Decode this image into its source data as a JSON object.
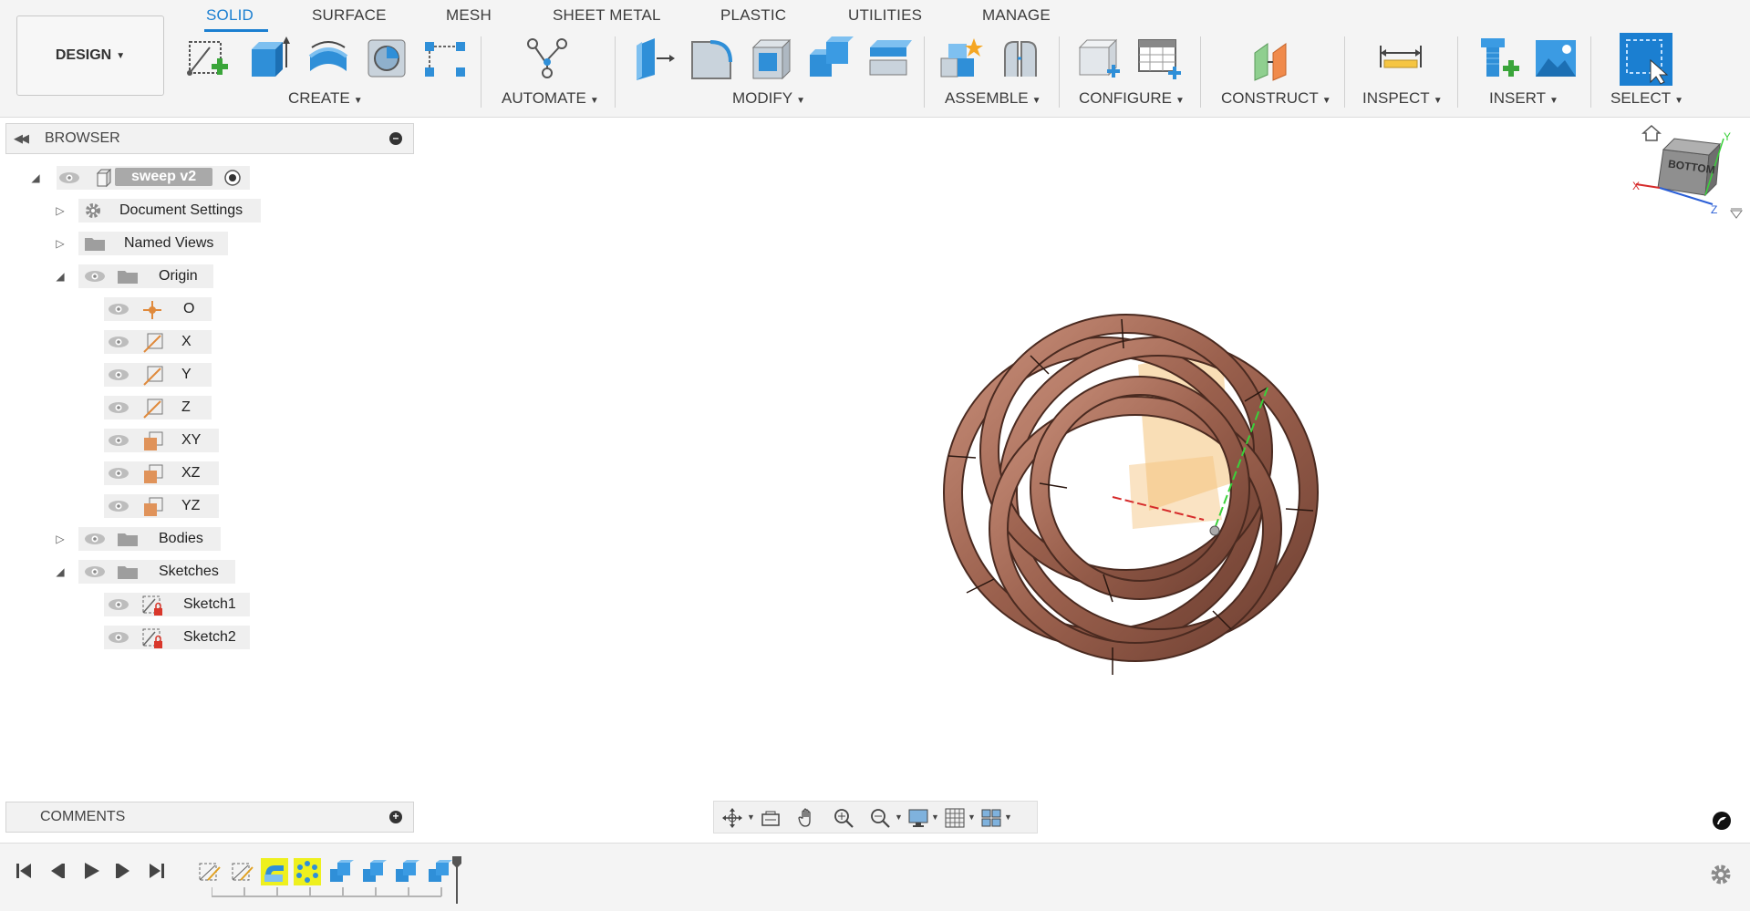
{
  "workspace": {
    "label": "DESIGN"
  },
  "tabs": [
    {
      "label": "SOLID",
      "active": true
    },
    {
      "label": "SURFACE"
    },
    {
      "label": "MESH"
    },
    {
      "label": "SHEET METAL"
    },
    {
      "label": "PLASTIC"
    },
    {
      "label": "UTILITIES"
    },
    {
      "label": "MANAGE"
    }
  ],
  "groups": {
    "create": "CREATE",
    "automate": "AUTOMATE",
    "modify": "MODIFY",
    "assemble": "ASSEMBLE",
    "configure": "CONFIGURE",
    "construct": "CONSTRUCT",
    "inspect": "INSPECT",
    "insert": "INSERT",
    "select": "SELECT"
  },
  "browser": {
    "title": "BROWSER",
    "root": "sweep v2",
    "items": {
      "document_settings": "Document Settings",
      "named_views": "Named Views",
      "origin": "Origin",
      "o": "O",
      "x": "X",
      "y": "Y",
      "z": "Z",
      "xy": "XY",
      "xz": "XZ",
      "yz": "YZ",
      "bodies": "Bodies",
      "sketches": "Sketches",
      "sketch1": "Sketch1",
      "sketch2": "Sketch2"
    }
  },
  "comments": {
    "title": "COMMENTS"
  },
  "viewcube": {
    "face": "BOTTOM"
  },
  "colors": {
    "accent": "#1b7fd1",
    "tube": "#a8705a",
    "highlight": "#eef01e",
    "plane": "#f4c27a"
  }
}
